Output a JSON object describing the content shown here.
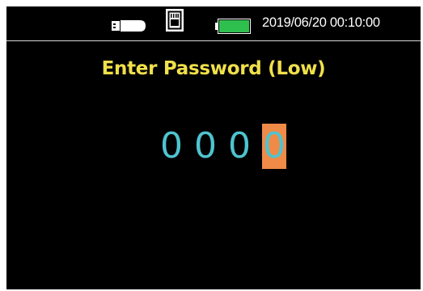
{
  "status_bar": {
    "usb_icon": "usb-drive-icon",
    "lan_icon": "ethernet-port-icon",
    "battery_icon": "battery-icon",
    "battery_level": 1.0,
    "datetime": "2019/06/20 00:10:00"
  },
  "title": "Enter Password (Low)",
  "pin": {
    "digits": [
      "0",
      "0",
      "0",
      "0"
    ],
    "active_index": 3
  },
  "colors": {
    "screen_bg": "#000000",
    "title": "#f0e04a",
    "digit": "#4fc4cf",
    "cursor": "#f08a47",
    "battery_fill": "#2fbf4f"
  }
}
